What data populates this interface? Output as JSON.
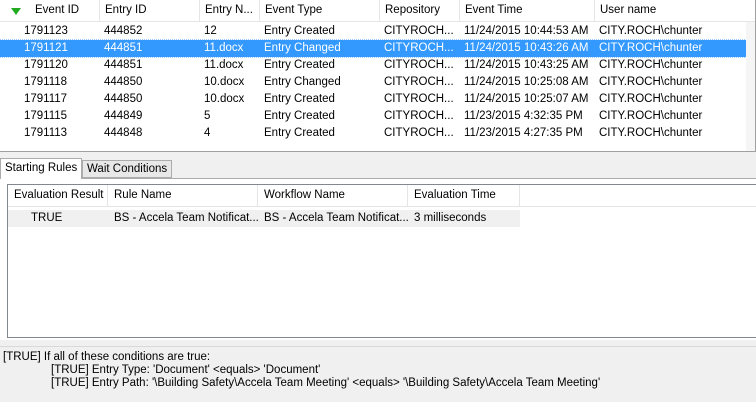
{
  "events": {
    "columns": [
      "Event ID",
      "Entry ID",
      "Entry N...",
      "Event Type",
      "Repository",
      "Event Time",
      "User name"
    ],
    "rows": [
      {
        "event_id": "1791123",
        "entry_id": "444852",
        "entry_name": "12",
        "event_type": "Entry Created",
        "repository": "CITYROCH...",
        "event_time": "11/24/2015 10:44:53 AM",
        "user_name": "CITY.ROCH\\chunter",
        "selected": false
      },
      {
        "event_id": "1791121",
        "entry_id": "444851",
        "entry_name": "11.docx",
        "event_type": "Entry Changed",
        "repository": "CITYROCH...",
        "event_time": "11/24/2015 10:43:26 AM",
        "user_name": "CITY.ROCH\\chunter",
        "selected": true
      },
      {
        "event_id": "1791120",
        "entry_id": "444851",
        "entry_name": "11.docx",
        "event_type": "Entry Created",
        "repository": "CITYROCH...",
        "event_time": "11/24/2015 10:43:25 AM",
        "user_name": "CITY.ROCH\\chunter",
        "selected": false
      },
      {
        "event_id": "1791118",
        "entry_id": "444850",
        "entry_name": "10.docx",
        "event_type": "Entry Changed",
        "repository": "CITYROCH...",
        "event_time": "11/24/2015 10:25:08 AM",
        "user_name": "CITY.ROCH\\chunter",
        "selected": false
      },
      {
        "event_id": "1791117",
        "entry_id": "444850",
        "entry_name": "10.docx",
        "event_type": "Entry Created",
        "repository": "CITYROCH...",
        "event_time": "11/24/2015 10:25:07 AM",
        "user_name": "CITY.ROCH\\chunter",
        "selected": false
      },
      {
        "event_id": "1791115",
        "entry_id": "444849",
        "entry_name": "5",
        "event_type": "Entry Created",
        "repository": "CITYROCH...",
        "event_time": "11/23/2015 4:32:35 PM",
        "user_name": "CITY.ROCH\\chunter",
        "selected": false
      },
      {
        "event_id": "1791113",
        "entry_id": "444848",
        "entry_name": "4",
        "event_type": "Entry Created",
        "repository": "CITYROCH...",
        "event_time": "11/23/2015 4:27:35 PM",
        "user_name": "CITY.ROCH\\chunter",
        "selected": false
      }
    ],
    "sort_icon": "sort-descending-icon",
    "sort_color": "#22aa22",
    "selection_color": "#3399ff"
  },
  "tabs": [
    {
      "label": "Starting Rules",
      "active": true
    },
    {
      "label": "Wait Conditions",
      "active": false
    }
  ],
  "rules": {
    "columns": [
      "Evaluation Result",
      "Rule Name",
      "Workflow Name",
      "Evaluation Time"
    ],
    "rows": [
      {
        "result": "TRUE",
        "rule_name": "BS - Accela Team Notificat...",
        "workflow_name": "BS - Accela Team Notificat...",
        "evaluation_time": "3 milliseconds"
      }
    ]
  },
  "details": {
    "lines": [
      "[TRUE] If all of these conditions are true:",
      "[TRUE] Entry Type: 'Document' <equals> 'Document'",
      "[TRUE] Entry Path: '\\Building Safety\\Accela Team Meeting' <equals> '\\Building Safety\\Accela Team Meeting'"
    ]
  }
}
